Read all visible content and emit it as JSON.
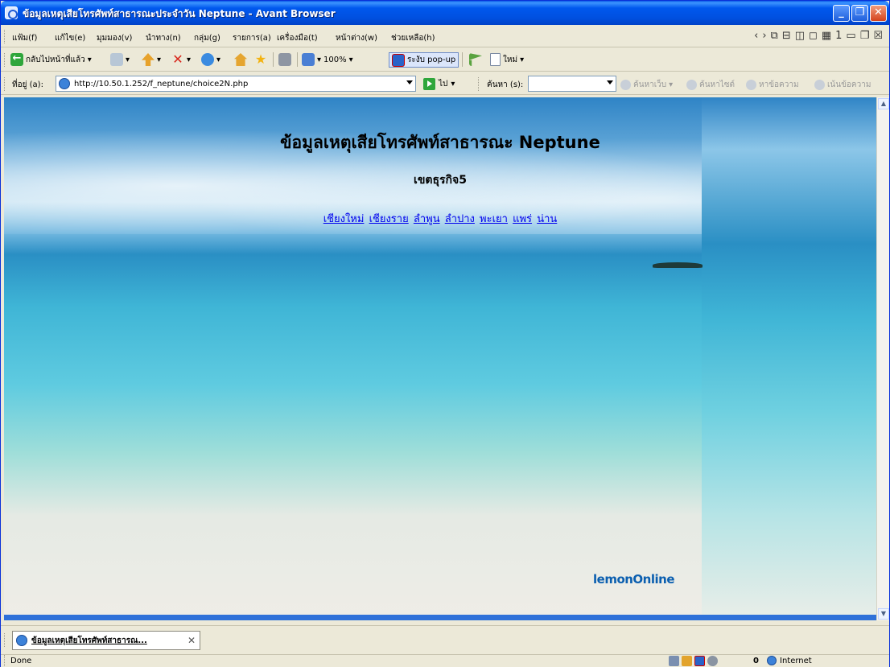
{
  "window": {
    "title": "ข้อมูลเหตุเสียโทรศัพท์สาธารณะประจำวัน Neptune - Avant Browser",
    "minimize": "_",
    "maximize": "❐",
    "close": "✕"
  },
  "menu": {
    "items": [
      "แฟ้ม(f)",
      "แก้ไข(e)",
      "มุมมอง(v)",
      "นำทาง(n)",
      "กลุ่ม(g)",
      "รายการ(a)",
      "เครื่องมือ(t)",
      "หน้าต่าง(w)",
      "ช่วยเหลือ(h)"
    ],
    "mdi_controls": [
      "‹",
      "›",
      "⧉",
      "⊟",
      "◫",
      "◻",
      "▦",
      "1",
      "▭",
      "❐",
      "☒"
    ]
  },
  "toolbar": {
    "back_label": "กลับไปหน้าที่แล้ว",
    "zoom": "100%",
    "popup_label": "ระงับ pop-up",
    "new_label": "ใหม่"
  },
  "address": {
    "label": "ที่อยู่ (a):",
    "url": "http://10.50.1.252/f_neptune/choice2N.php",
    "go_label": "ไป",
    "search_label": "ค้นหา (s):",
    "search_value": "",
    "search_web": "ค้นหาเว็บ",
    "search_site": "ค้นหาไซต์",
    "find_text": "หาข้อความ",
    "highlight": "เน้นข้อความ"
  },
  "page": {
    "title": "ข้อมูลเหตุเสียโทรศัพท์สาธารณะ Neptune",
    "subtitle": "เขตธุรกิจ5",
    "provinces": [
      "เชียงใหม่",
      "เชียงราย",
      "ลำพูน",
      "ลำปาง",
      "พะเยา",
      "แพร่",
      "น่าน"
    ],
    "brand": "lemonOnline"
  },
  "tabs": [
    {
      "label": "ข้อมูลเหตุเสียโทรศัพท์สาธารณ...",
      "close": "✕"
    }
  ],
  "status": {
    "text": "Done",
    "count": "0",
    "zone": "Internet"
  },
  "colors": {
    "titlebar": "#0058ee",
    "link": "#0000ee",
    "brand": "#0b5fb0"
  }
}
